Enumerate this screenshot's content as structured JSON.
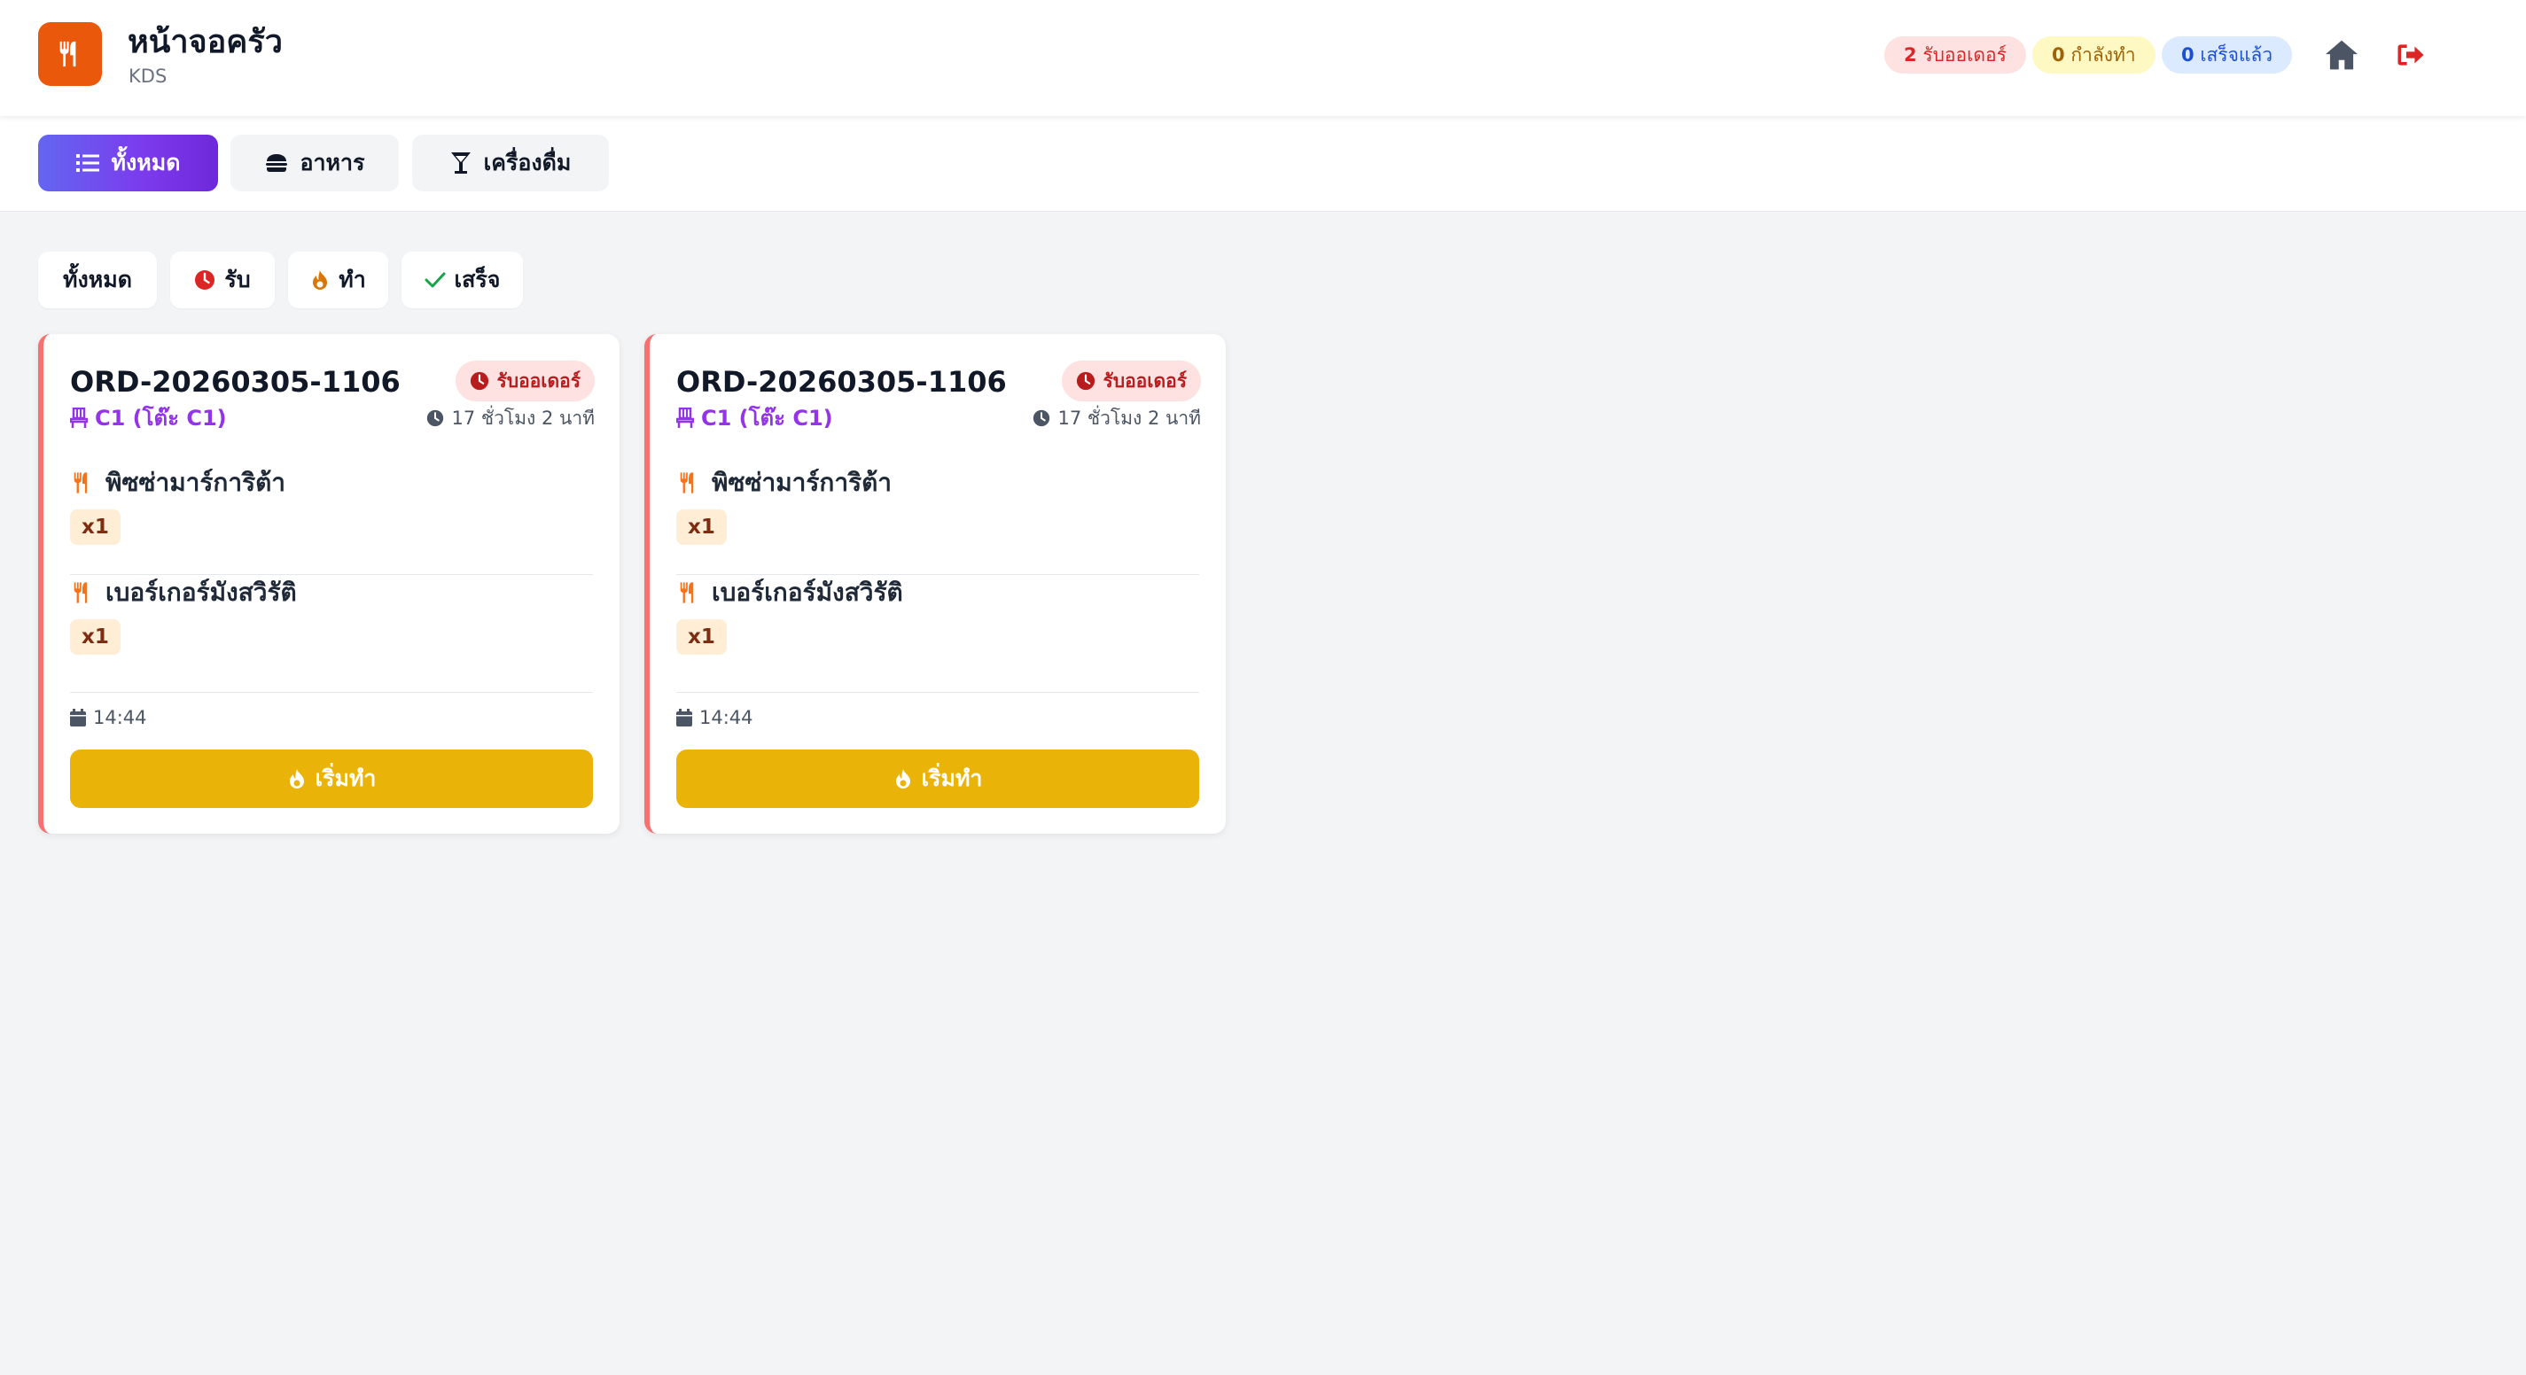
{
  "app": {
    "title": "หน้าจอครัว",
    "subtitle": "KDS",
    "accent": "#ea580c"
  },
  "header": {
    "badges": {
      "new_count": "2",
      "new_label": "รับออเดอร์",
      "cooking_count": "0",
      "cooking_label": "กำลังทำ",
      "done_count": "0",
      "done_label": "เสร็จแล้ว"
    },
    "icons": [
      "home-icon",
      "logout-icon"
    ]
  },
  "category_tabs": [
    {
      "label": "ทั้งหมด",
      "icon": "list-icon",
      "active": true
    },
    {
      "label": "อาหาร",
      "icon": "burger-icon",
      "active": false
    },
    {
      "label": "เครื่องดื่ม",
      "icon": "cocktail-icon",
      "active": false
    }
  ],
  "status_filters": [
    {
      "label": "ทั้งหมด",
      "icon": ""
    },
    {
      "label": "รับ",
      "icon": "clock-icon"
    },
    {
      "label": "ทำ",
      "icon": "fire-icon"
    },
    {
      "label": "เสร็จ",
      "icon": "check-icon"
    }
  ],
  "orders": [
    {
      "order_no": "ORD-20260305-1106",
      "table": "C1 (โต๊ะ C1)",
      "status": "รับออเดอร์",
      "elapsed": "17 ชั่วโมง 2 นาที",
      "items": [
        {
          "name": "พิซซ่ามาร์การิต้า",
          "qty": "x1"
        },
        {
          "name": "เบอร์เกอร์มังสวิรัติ",
          "qty": "x1"
        }
      ],
      "time": "14:44",
      "action": "เริ่มทำ"
    },
    {
      "order_no": "ORD-20260305-1106",
      "table": "C1 (โต๊ะ C1)",
      "status": "รับออเดอร์",
      "elapsed": "17 ชั่วโมง 2 นาที",
      "items": [
        {
          "name": "พิซซ่ามาร์การิต้า",
          "qty": "x1"
        },
        {
          "name": "เบอร์เกอร์มังสวิรัติ",
          "qty": "x1"
        }
      ],
      "time": "14:44",
      "action": "เริ่มทำ"
    }
  ],
  "colors": {
    "new": "#dc2626",
    "cooking": "#a16207",
    "done": "#1d4ed8",
    "table": "#9333ea",
    "action": "#eab308"
  }
}
